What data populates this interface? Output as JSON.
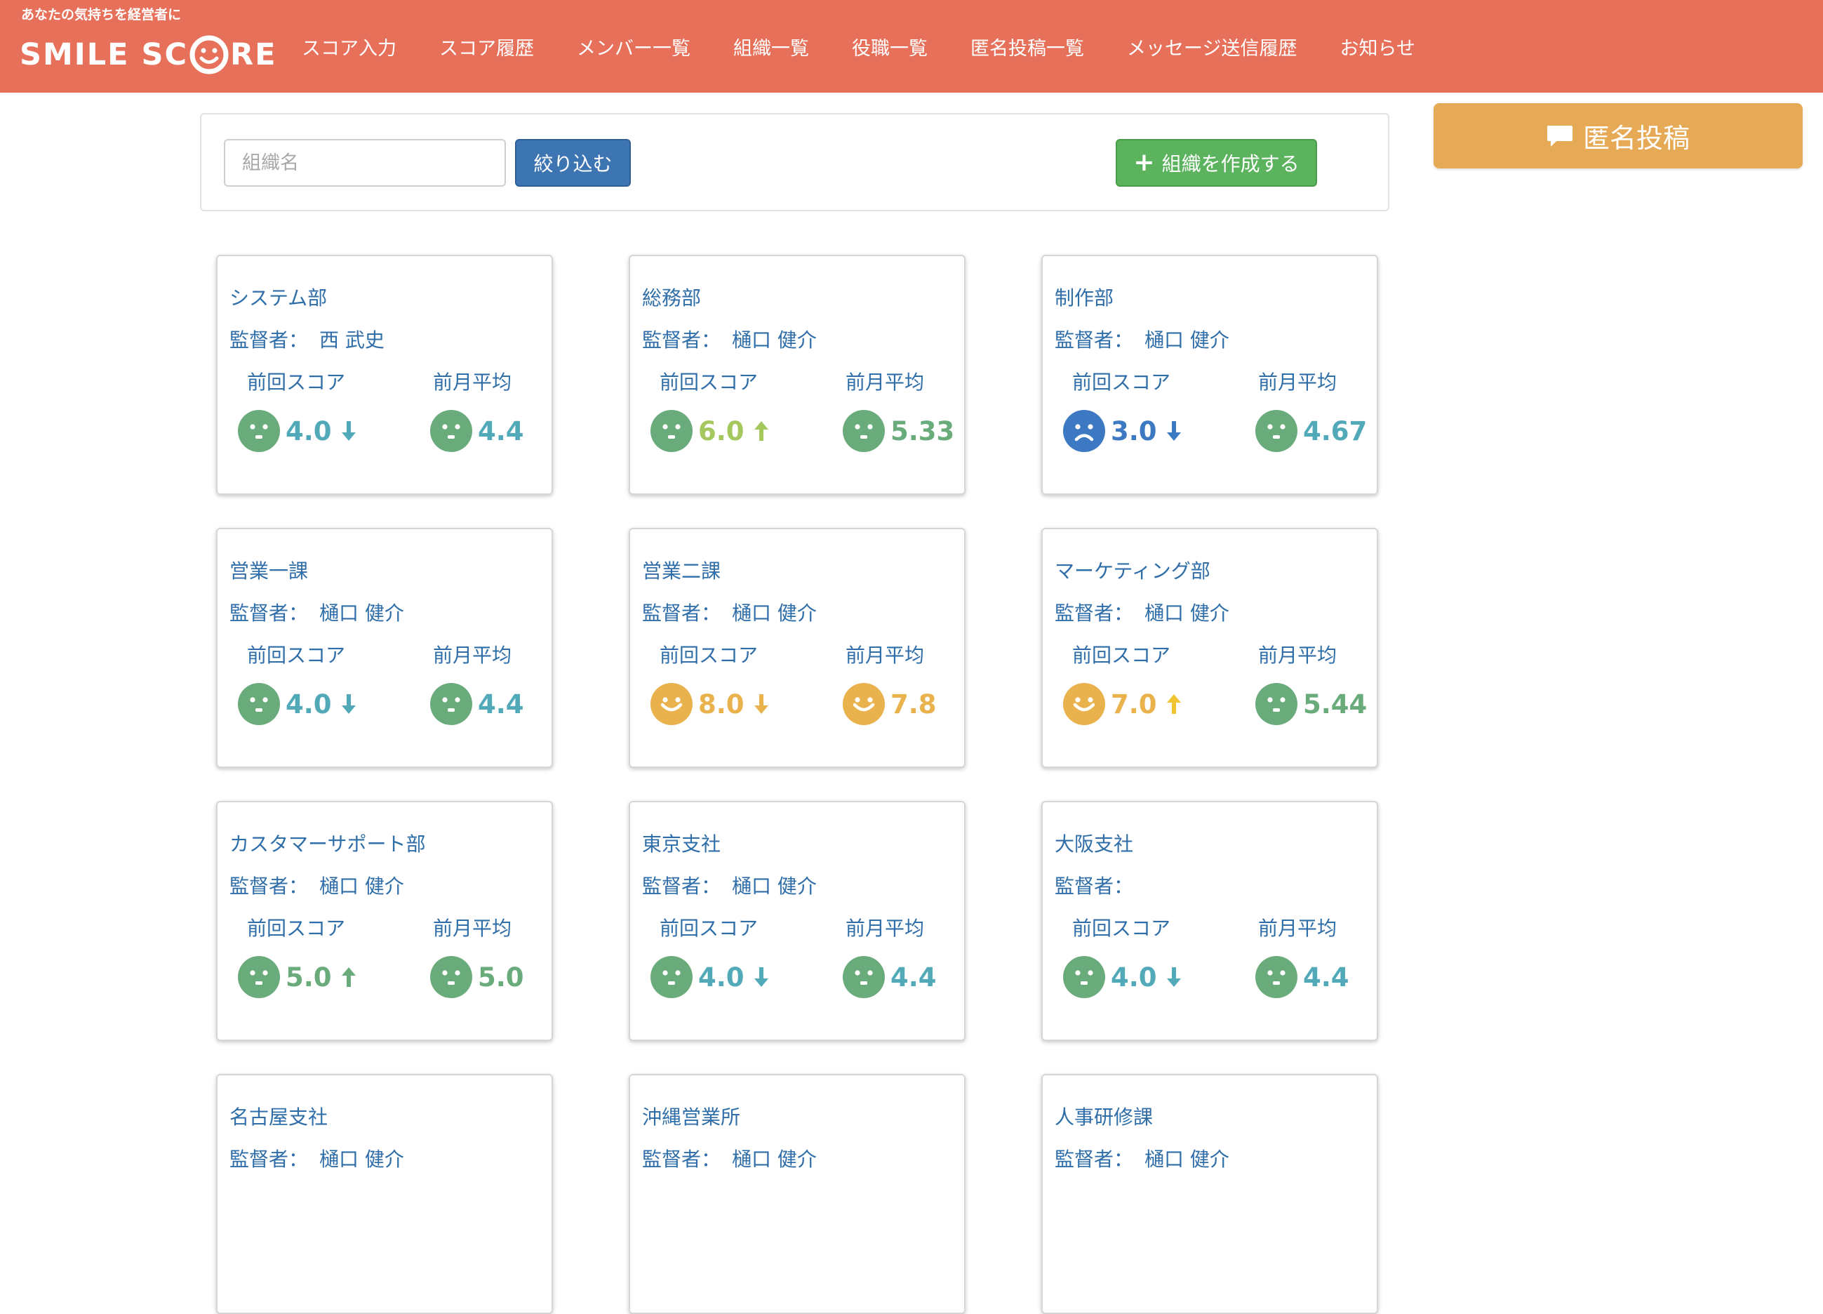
{
  "header": {
    "tagline": "あなたの気持ちを経営者に",
    "logo_text_a": "SMILE SC",
    "logo_text_b": "RE",
    "nav": [
      "スコア入力",
      "スコア履歴",
      "メンバー一覧",
      "組織一覧",
      "役職一覧",
      "匿名投稿一覧",
      "メッセージ送信履歴",
      "お知らせ"
    ]
  },
  "filter": {
    "placeholder": "組織名",
    "filter_button": "絞り込む",
    "create_button": "組織を作成する"
  },
  "anon_button": "匿名投稿",
  "colors": {
    "header": "#e7705a",
    "green_face": "#6aab7b",
    "teal_text": "#52aab9",
    "blue": "#3d79c2",
    "orange": "#e9b24d",
    "lime": "#a4c85e",
    "yellow_arrow": "#f0c530"
  },
  "card_labels": {
    "supervisor": "監督者：",
    "last_score": "前回スコア",
    "last_month_avg": "前月平均"
  },
  "orgs": [
    {
      "name": "システム部",
      "supervisor": "西 武史",
      "score": "4.0",
      "score_face": "neutral",
      "score_color": "teal",
      "trend": "down",
      "trend_color": "teal",
      "avg": "4.4",
      "avg_face": "neutral",
      "avg_color": "teal"
    },
    {
      "name": "総務部",
      "supervisor": "樋口 健介",
      "score": "6.0",
      "score_face": "neutral",
      "score_color": "lime",
      "trend": "up",
      "trend_color": "lime",
      "avg": "5.33",
      "avg_face": "neutral",
      "avg_color": "green"
    },
    {
      "name": "制作部",
      "supervisor": "樋口 健介",
      "score": "3.0",
      "score_face": "sad",
      "score_color": "blue",
      "trend": "down",
      "trend_color": "blue",
      "avg": "4.67",
      "avg_face": "neutral",
      "avg_color": "teal"
    },
    {
      "name": "営業一課",
      "supervisor": "樋口 健介",
      "score": "4.0",
      "score_face": "neutral",
      "score_color": "teal",
      "trend": "down",
      "trend_color": "teal",
      "avg": "4.4",
      "avg_face": "neutral",
      "avg_color": "teal"
    },
    {
      "name": "営業二課",
      "supervisor": "樋口 健介",
      "score": "8.0",
      "score_face": "happy",
      "score_color": "orange",
      "trend": "down",
      "trend_color": "orange",
      "avg": "7.8",
      "avg_face": "happy",
      "avg_color": "orange"
    },
    {
      "name": "マーケティング部",
      "supervisor": "樋口 健介",
      "score": "7.0",
      "score_face": "happy",
      "score_color": "orange",
      "trend": "up",
      "trend_color": "yellow",
      "avg": "5.44",
      "avg_face": "neutral",
      "avg_color": "green"
    },
    {
      "name": "カスタマーサポート部",
      "supervisor": "樋口 健介",
      "score": "5.0",
      "score_face": "neutral",
      "score_color": "green",
      "trend": "up",
      "trend_color": "green",
      "avg": "5.0",
      "avg_face": "neutral",
      "avg_color": "green"
    },
    {
      "name": "東京支社",
      "supervisor": "樋口 健介",
      "score": "4.0",
      "score_face": "neutral",
      "score_color": "teal",
      "trend": "down",
      "trend_color": "teal",
      "avg": "4.4",
      "avg_face": "neutral",
      "avg_color": "teal"
    },
    {
      "name": "大阪支社",
      "supervisor": "",
      "score": "4.0",
      "score_face": "neutral",
      "score_color": "teal",
      "trend": "down",
      "trend_color": "teal",
      "avg": "4.4",
      "avg_face": "neutral",
      "avg_color": "teal"
    },
    {
      "name": "名古屋支社",
      "supervisor": "樋口 健介"
    },
    {
      "name": "沖縄営業所",
      "supervisor": "樋口 健介"
    },
    {
      "name": "人事研修課",
      "supervisor": "樋口 健介"
    }
  ]
}
